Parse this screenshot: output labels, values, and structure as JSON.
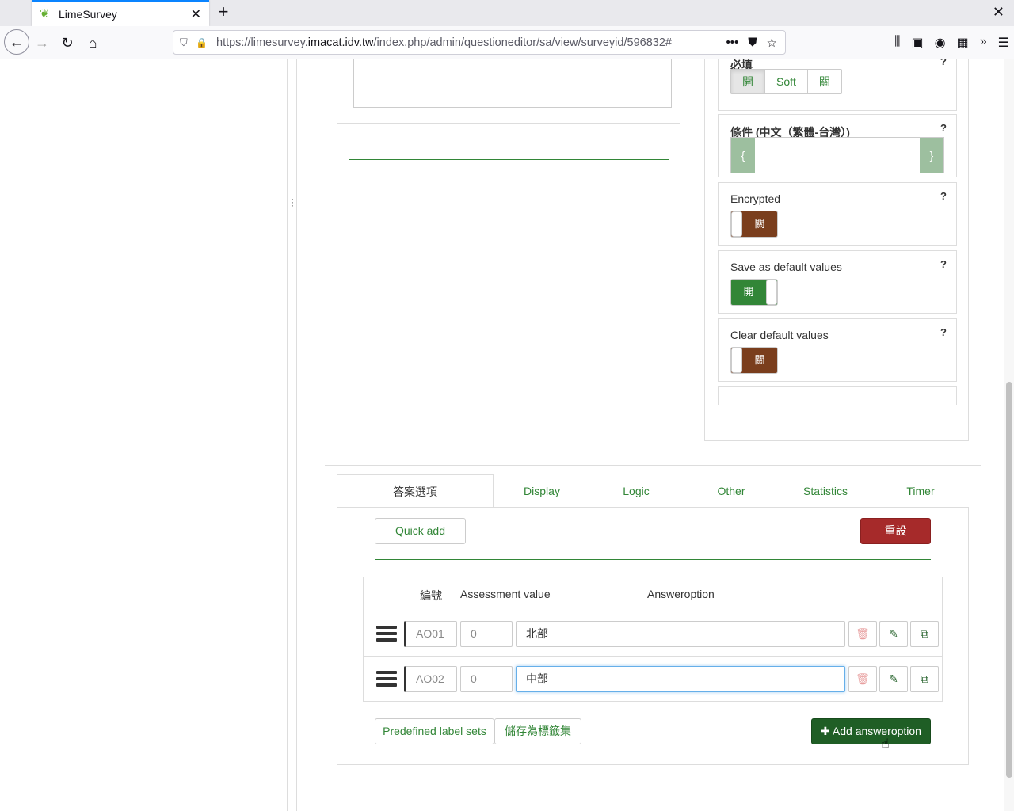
{
  "browser": {
    "tab_title": "LimeSurvey",
    "url_prefix": "https://limesurvey.",
    "url_domain": "imacat.idv.tw",
    "url_path": "/index.php/admin/questioneditor/sa/view/surveyid/596832#"
  },
  "settings": {
    "mandatory": {
      "label": "必填",
      "help": "?",
      "options": [
        "開",
        "Soft",
        "關"
      ],
      "active": "開"
    },
    "condition": {
      "label": "條件 (中文（繁體-台灣）)",
      "help": "?",
      "open_brace": "{",
      "close_brace": "}"
    },
    "encrypted": {
      "label": "Encrypted",
      "help": "?",
      "state": "關"
    },
    "save_default": {
      "label": "Save as default values",
      "help": "?",
      "state": "開"
    },
    "clear_default": {
      "label": "Clear default values",
      "help": "?",
      "state": "關"
    }
  },
  "tabs": [
    "答案選項",
    "Display",
    "Logic",
    "Other",
    "Statistics",
    "Timer"
  ],
  "answers": {
    "quick_add": "Quick add",
    "reset": "重設",
    "headers": {
      "code": "編號",
      "assessment": "Assessment value",
      "answeroption": "Answeroption"
    },
    "rows": [
      {
        "code": "AO01",
        "assessment": "0",
        "text": "北部"
      },
      {
        "code": "AO02",
        "assessment": "0",
        "text": "中部"
      }
    ],
    "predefined": "Predefined label sets",
    "save_label": "儲存為標籤集",
    "add_option": "Add answeroption"
  },
  "colors": {
    "accent": "#328637",
    "danger": "#a62a2a",
    "toggle_off": "#7a3e1d",
    "primary": "#1f5e25"
  }
}
